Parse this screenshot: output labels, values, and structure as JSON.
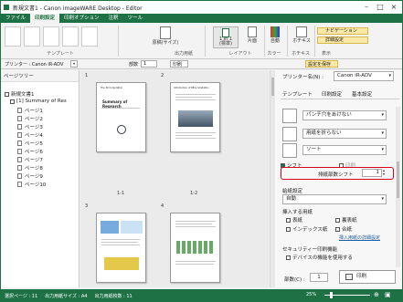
{
  "window": {
    "title": "新規文書1 - Canon imageWARE Desktop - Editor"
  },
  "tabs": [
    "ファイル",
    "印刷設定",
    "印刷オプション",
    "注釈",
    "ツール"
  ],
  "ribbon": {
    "templates_group": "テンプレート",
    "paper_size_label": "原稿(サイズ)",
    "output_group": "出力用紙",
    "layout_1in1_label": "1 in 1\n(標準)",
    "duplex_label": "片面",
    "layout_group": "レイアウト",
    "color_label": "自動",
    "color_group": "カラー",
    "stamp_label": "ホチキス",
    "staple_group": "ホチキス",
    "navigation_label": "ナビゲーション",
    "detail_label": "詳細設定",
    "view_group": "表示"
  },
  "toolbar": {
    "printer_label": "プリンター : Canon iR-ADV",
    "copies_label": "部数",
    "copies_value": "1",
    "print_label": "印刷",
    "print_settings_label": "設定を保存"
  },
  "tree": {
    "header": "ページツリー",
    "doc": "新規文書1",
    "section": "[1] Summary of Res",
    "pages": [
      "ページ1",
      "ページ2",
      "ページ3",
      "ページ4",
      "ページ5",
      "ページ6",
      "ページ7",
      "ページ8",
      "ページ9",
      "ページ10"
    ]
  },
  "preview": {
    "page_headers": [
      "1",
      "2",
      "3",
      "4"
    ],
    "page_labels": [
      "1-1",
      "1-2"
    ],
    "page1_header": "The 30 Corporation",
    "page1_title": "Summary of Research",
    "page2_title": "Introduction of RB & Gradation"
  },
  "panel": {
    "printer_label": "プリンター名(N) :",
    "printer_value": "Canon iR-ADV",
    "tabs": [
      "テンプレート",
      "印刷設定",
      "基本設定"
    ],
    "punch_value": "パンチ穴をあけない",
    "fold_value": "用紙を折らない",
    "sort_value": "ソート",
    "shift_label": "シフト",
    "print_label": "印刷",
    "shift_count_label": "排紙部数シフト",
    "shift_count_value": "1",
    "paper_source_label": "給紙設定",
    "paper_source_value": "自動",
    "insert_label": "挿入する用紙",
    "cover_label": "表紙",
    "back_cover_label": "裏表紙",
    "index_label": "インデックス紙",
    "slip_label": "合紙",
    "insert_settings_label": "挿入用紙の詳細設定",
    "security_label": "セキュリティー印刷機能",
    "device_feature_label": "デバイスの機能を使用する",
    "copies_label": "部数(C) :",
    "copies_value": "1",
    "print_button": "印刷"
  },
  "status": {
    "selected_page": "選択ページ : 11",
    "output_size": "出力用紙サイズ : A4",
    "output_count": "出力用紙枚数 : 11",
    "zoom": "25%"
  },
  "colors": {
    "accent": "#1e7145",
    "highlight": "#d9001b"
  }
}
